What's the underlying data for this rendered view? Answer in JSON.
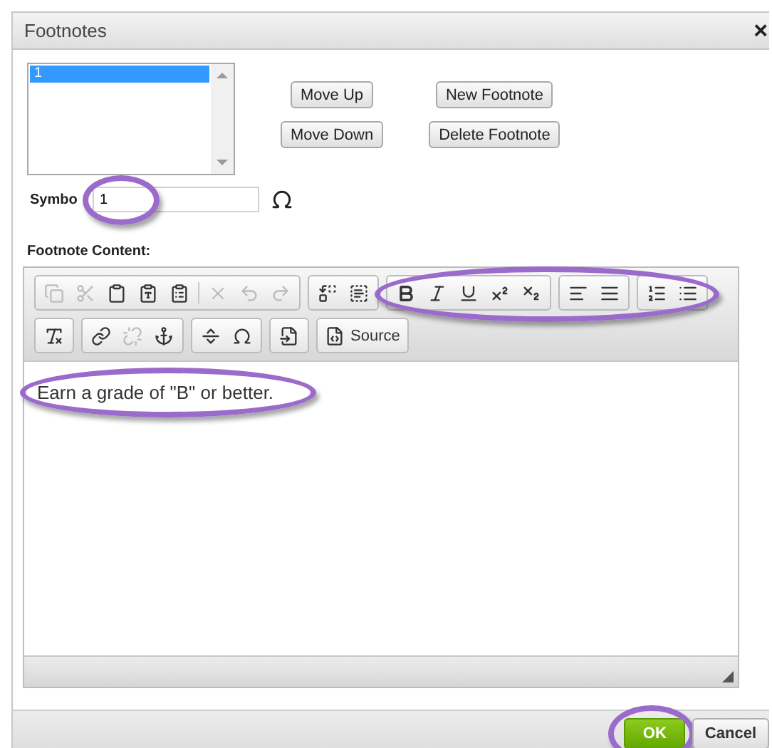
{
  "dialog": {
    "title": "Footnotes",
    "close": "×"
  },
  "footnote_list": {
    "items": [
      {
        "label": "1",
        "selected": true
      }
    ]
  },
  "buttons": [
    {
      "label": "Move Up"
    },
    {
      "label": "New Footnote"
    },
    {
      "label": "Move Down"
    },
    {
      "label": "Delete Footnote"
    }
  ],
  "symbol": {
    "label": "Symbo",
    "value": "1",
    "highlighted": true
  },
  "content_label": "Footnote Content:",
  "toolbar": {
    "rows": [
      [
        {
          "highlighted": false,
          "buttons": [
            {
              "kind": "copy",
              "disabled": true
            },
            {
              "kind": "cut",
              "disabled": true
            },
            {
              "kind": "paste",
              "disabled": false
            },
            {
              "kind": "paste-text",
              "disabled": false
            },
            {
              "kind": "paste-word",
              "disabled": false
            },
            {
              "kind": "separator"
            },
            {
              "kind": "remove",
              "disabled": true
            },
            {
              "kind": "undo",
              "disabled": true
            },
            {
              "kind": "redo",
              "disabled": true
            }
          ]
        },
        {
          "highlighted": false,
          "buttons": [
            {
              "kind": "replace",
              "disabled": false
            },
            {
              "kind": "select-all",
              "disabled": false
            }
          ]
        },
        {
          "highlighted": true,
          "buttons": [
            {
              "kind": "bold",
              "disabled": false
            },
            {
              "kind": "italic",
              "disabled": false
            },
            {
              "kind": "underline",
              "disabled": false
            },
            {
              "kind": "superscript",
              "disabled": false
            },
            {
              "kind": "subscript",
              "disabled": false
            }
          ]
        },
        {
          "highlighted": true,
          "buttons": [
            {
              "kind": "align-left",
              "disabled": false
            },
            {
              "kind": "justify",
              "disabled": false
            }
          ]
        },
        {
          "highlighted": true,
          "buttons": [
            {
              "kind": "numbered-list",
              "disabled": false
            },
            {
              "kind": "bulleted-list",
              "disabled": false
            }
          ]
        }
      ],
      [
        {
          "highlighted": false,
          "buttons": [
            {
              "kind": "clear-format",
              "disabled": false
            }
          ]
        },
        {
          "highlighted": false,
          "buttons": [
            {
              "kind": "link",
              "disabled": false
            },
            {
              "kind": "unlink",
              "disabled": true
            },
            {
              "kind": "anchor",
              "disabled": false
            }
          ]
        },
        {
          "highlighted": false,
          "buttons": [
            {
              "kind": "horizontal-rule",
              "disabled": false
            },
            {
              "kind": "special-char",
              "disabled": false
            }
          ]
        },
        {
          "highlighted": false,
          "buttons": [
            {
              "kind": "template",
              "disabled": false
            }
          ]
        },
        {
          "highlighted": false,
          "buttons": [
            {
              "kind": "source",
              "disabled": false,
              "label": "Source"
            }
          ]
        }
      ]
    ]
  },
  "content": {
    "text": "Earn a grade of \"B\" or better.",
    "highlighted": true
  },
  "footer": {
    "buttons": [
      {
        "label": "OK",
        "kind": "primary",
        "highlighted": true
      },
      {
        "label": "Cancel",
        "kind": "secondary",
        "highlighted": false
      }
    ]
  }
}
